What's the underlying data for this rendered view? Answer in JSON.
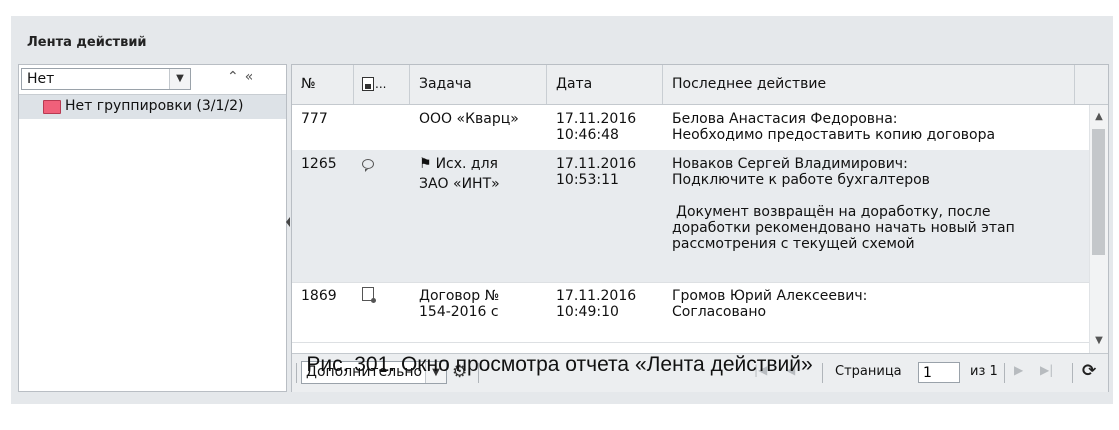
{
  "window": {
    "title": "Лента действий"
  },
  "left_pane": {
    "grouping_select": {
      "value": "Нет"
    },
    "tools": {
      "collapse_all": "≈",
      "hide_panel": "«"
    },
    "tree": [
      {
        "label": "Нет группировки (3/1/2)",
        "color": "#f0607a"
      }
    ]
  },
  "grid": {
    "columns": {
      "num": "№",
      "file": "...",
      "task": "Задача",
      "date": "Дата",
      "action": "Последнее действие"
    },
    "rows": [
      {
        "num": "777",
        "icon": "",
        "task": "ООО «Кварц»",
        "date_line1": "17.11.2016",
        "date_line2": "10:46:48",
        "action_line1": "Белова Анастасия Федоровна:",
        "action_line2": "Необходимо предоставить копию договора",
        "action_note": ""
      },
      {
        "num": "1265",
        "icon": "comment-icon",
        "flag": "⚑",
        "task_line1": "Исх. для",
        "task_line2": "ЗАО «ИНТ»",
        "date_line1": "17.11.2016",
        "date_line2": "10:53:11",
        "action_line1": "Новаков Сергей Владимирович:",
        "action_line2": "Подключите к работе бухгалтеров",
        "action_note_1": "Документ возвращён на доработку, после",
        "action_note_2": "доработки рекомендовано начать новый этап",
        "action_note_3": "рассмотрения с текущей схемой"
      },
      {
        "num": "1869",
        "icon": "document-icon",
        "task_line1": "Договор №",
        "task_line2": "154-2016 с",
        "date_line1": "17.11.2016",
        "date_line2": "10:49:10",
        "action_line1": "Громов Юрий Алексеевич:",
        "action_line2": "Согласовано"
      }
    ]
  },
  "toolbar": {
    "more_select": {
      "value": "Дополнительно"
    },
    "pager": {
      "page_label": "Страница",
      "page_value": "1",
      "of_label": "из 1"
    }
  },
  "caption": "Рис. 301. Окно просмотра отчета «Лента действий»"
}
